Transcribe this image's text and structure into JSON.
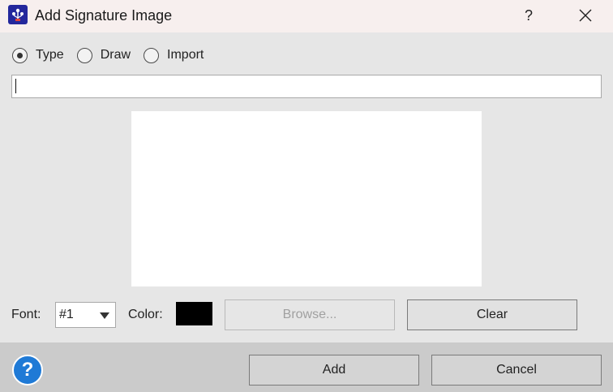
{
  "window": {
    "title": "Add Signature Image",
    "help_glyph": "?",
    "icon": "app-logo-icon",
    "close_icon": "close-icon"
  },
  "mode": {
    "selected": "Type",
    "options": [
      {
        "label": "Type",
        "selected": true
      },
      {
        "label": "Draw",
        "selected": false
      },
      {
        "label": "Import",
        "selected": false
      }
    ]
  },
  "signature_text": {
    "value": ""
  },
  "controls": {
    "font_label": "Font:",
    "font_value": "#1",
    "color_label": "Color:",
    "color_value": "#000000",
    "browse_label": "Browse...",
    "clear_label": "Clear"
  },
  "footer": {
    "help_glyph": "?",
    "add_label": "Add",
    "cancel_label": "Cancel"
  },
  "colors": {
    "titlebar_bg": "#f7efee",
    "dialog_bg": "#e6e6e6",
    "footer_bg": "#cbcbcb",
    "help_blue": "#1f7ad6",
    "app_icon_bg": "#23279c"
  }
}
